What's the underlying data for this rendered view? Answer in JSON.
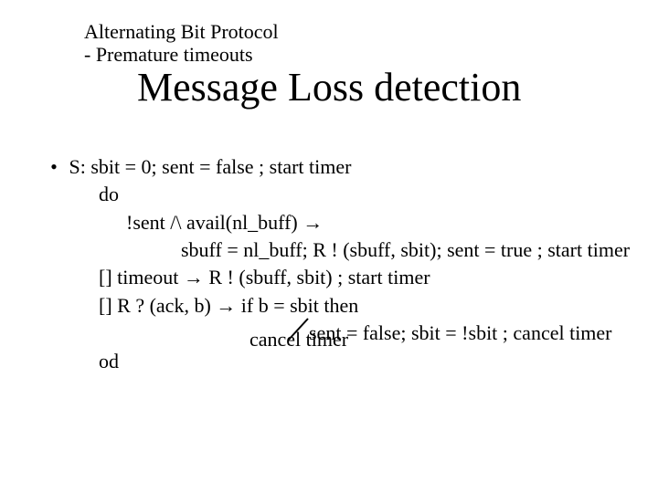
{
  "header": {
    "line1": "Alternating Bit Protocol",
    "line2": "- Premature timeouts"
  },
  "title": "Message Loss detection",
  "lines": {
    "l1a": "S:  sbit = 0; sent = false",
    "l1b": " ; start timer",
    "l2": "do",
    "l3": "!sent /\\ avail(nl_buff) →",
    "l4a": "sbuff = nl_buff; R ! (sbuff, sbit); sent = true",
    "l4b": "  ; start timer",
    "l5a": "[]  timeout → R ! (sbuff, sbit)",
    "l5b": " ; start timer",
    "l6": "[]  R ? (ack, b) → if b = sbit then",
    "l7a": "sent = false; sbit = !sbit",
    "l7b": " ; cancel timer",
    "l8": "od",
    "cancel2": "cancel timer"
  }
}
